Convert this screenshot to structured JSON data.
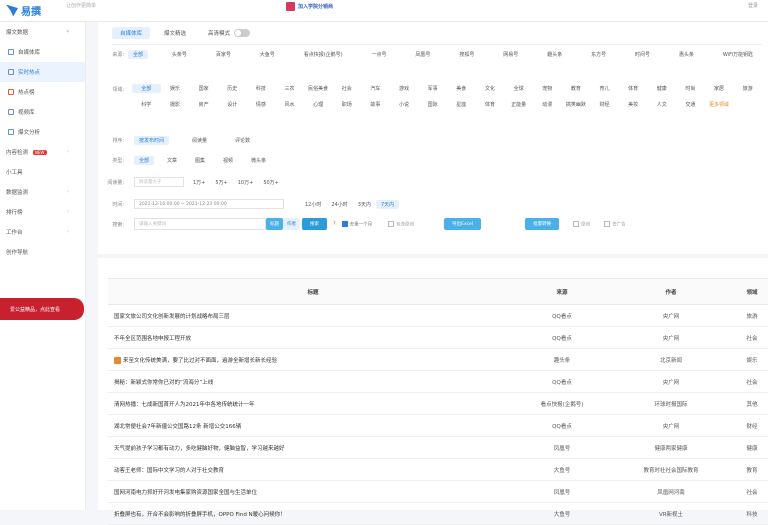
{
  "topbar": {
    "logo_text": "易撰",
    "subtitle": "让创作更简单",
    "banner_text": "加入学院分销商",
    "right_text": "登录"
  },
  "sidebar": {
    "items": [
      {
        "label": "爆文数据",
        "icon": "grid-icon"
      },
      {
        "label": "自媒体库",
        "icon": "media-icon"
      },
      {
        "label": "实时热点",
        "icon": "hot-icon"
      },
      {
        "label": "热点榜",
        "icon": "rank-icon"
      },
      {
        "label": "视频库",
        "icon": "video-icon"
      },
      {
        "label": "爆文分析",
        "icon": "chart-icon"
      },
      {
        "label": "内容检测",
        "badge": "NEW"
      },
      {
        "label": "小工具"
      },
      {
        "label": "数据监测"
      },
      {
        "label": "排行榜"
      },
      {
        "label": "工作台"
      },
      {
        "label": "创作导航"
      }
    ],
    "promo": "爱公益精品，点此查看"
  },
  "tabs": [
    "自媒体库",
    "爆文精选"
  ],
  "toggle_label": "高清模式",
  "platform_label": "来源:",
  "platforms": [
    "全部",
    "头条号",
    "百家号",
    "大鱼号",
    "看点快报(企鹅号)",
    "一点号",
    "凤凰号",
    "搜狐号",
    "网易号",
    "趣头条",
    "东方号",
    "时间号",
    "惠头条",
    "WiFi万能钥匙"
  ],
  "field_label": "领域:",
  "fields": [
    "全部",
    "娱乐",
    "国家",
    "历史",
    "科技",
    "三农",
    "民俗美食",
    "社会",
    "汽车",
    "游戏",
    "军事",
    "美食",
    "文化",
    "全球",
    "宠物",
    "教育",
    "育儿",
    "体育",
    "健康",
    "时尚",
    "家居",
    "旅游",
    "科学",
    "摄影",
    "房产",
    "设计",
    "情感",
    "风水",
    "心理",
    "职场",
    "故事",
    "小说",
    "国际",
    "星座",
    "体育",
    "正能量",
    "动漫",
    "搞笑幽默",
    "财经",
    "美妆",
    "人文",
    "交通",
    "更多领域"
  ],
  "sort_label": "排序:",
  "sorts": [
    "按发布时间",
    "阅读量",
    "评论数"
  ],
  "type_label": "类型:",
  "types": [
    "全部",
    "文章",
    "图集",
    "视频",
    "微头条"
  ],
  "read_label": "阅读量:",
  "read_placeholder": "阅读量大于",
  "read_units": [
    "1万+",
    "5万+",
    "10万+",
    "50万+"
  ],
  "time_label": "时间:",
  "time_range": "2021-12-16 00:00 ~ 2021-12-23 00:00",
  "time_shortcuts": [
    "12小时",
    "24小时",
    "3天内",
    "7天内"
  ],
  "search_label": "搜索:",
  "search_placeholder": "请输入关键词",
  "search_modes": [
    "标题",
    "作者"
  ],
  "search_button": "搜索",
  "help_text": "?",
  "dedupe_label": "去重一个月",
  "include_note_label": "包含原创",
  "export_button": "导出Excel",
  "create_button": "批量转换",
  "original_label": "原创",
  "ad_label": "去广告",
  "table": {
    "headers": [
      "标题",
      "来源",
      "作者",
      "领域"
    ],
    "rows": [
      [
        "国家文旅公司文化创新发展的计划战略布局三层",
        "QQ看点",
        "央广网",
        "旅游"
      ],
      [
        "不年全区范围各地申报工程开放",
        "QQ看点",
        "央广网",
        "社会"
      ],
      [
        "来至文化传统美满，要了比过对不面面，遍游全新增长新长经验",
        "趣头条",
        "北京新闻",
        "娱乐"
      ],
      [
        "揭秘：新颖式你常你已对的“流海分”上线",
        "QQ看点",
        "央广网",
        "社会"
      ],
      [
        "清网热播：七成新国首开人为2021年中各地传统统计一年",
        "看点快报(企鹅号)",
        "环球时报国际",
        "其他"
      ],
      [
        "湖北常便社会7年新疆公交国路12条 新增公交166辆",
        "QQ看点",
        "央广网",
        "财经"
      ],
      [
        "天气提前孩子学习都有动力，多吃健脑好物，健脑益智，学习越来越好",
        "凤凰号",
        "健康两家健康",
        "健康"
      ],
      [
        "动客王老师：国际中文学习的人对于社交教育",
        "大鱼号",
        "教育时社社会国际教育",
        "教育"
      ],
      [
        "国网河南电力抓好开河发电集家购资源国家全国与生活单位",
        "凤凰号",
        "凤凰网河南",
        "社会"
      ],
      [
        "折叠屏也有，开合不会影响的折叠屏手机，OPPO Find N暖心问候你！",
        "大鱼号",
        "VR新视土",
        "科技"
      ]
    ]
  }
}
